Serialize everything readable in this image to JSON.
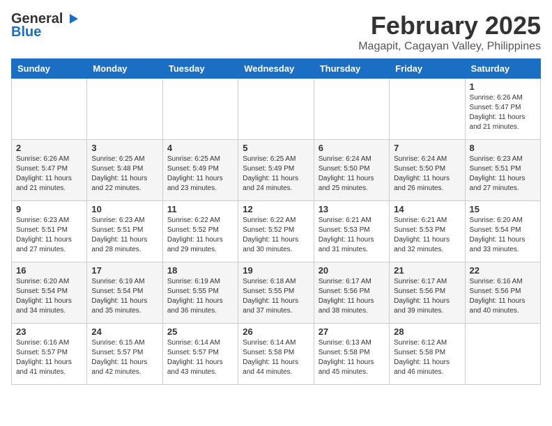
{
  "logo": {
    "general": "General",
    "blue": "Blue"
  },
  "title": "February 2025",
  "subtitle": "Magapit, Cagayan Valley, Philippines",
  "days_of_week": [
    "Sunday",
    "Monday",
    "Tuesday",
    "Wednesday",
    "Thursday",
    "Friday",
    "Saturday"
  ],
  "weeks": [
    [
      {
        "day": "",
        "info": ""
      },
      {
        "day": "",
        "info": ""
      },
      {
        "day": "",
        "info": ""
      },
      {
        "day": "",
        "info": ""
      },
      {
        "day": "",
        "info": ""
      },
      {
        "day": "",
        "info": ""
      },
      {
        "day": "1",
        "info": "Sunrise: 6:26 AM\nSunset: 5:47 PM\nDaylight: 11 hours\nand 21 minutes."
      }
    ],
    [
      {
        "day": "2",
        "info": "Sunrise: 6:26 AM\nSunset: 5:47 PM\nDaylight: 11 hours\nand 21 minutes."
      },
      {
        "day": "3",
        "info": "Sunrise: 6:25 AM\nSunset: 5:48 PM\nDaylight: 11 hours\nand 22 minutes."
      },
      {
        "day": "4",
        "info": "Sunrise: 6:25 AM\nSunset: 5:49 PM\nDaylight: 11 hours\nand 23 minutes."
      },
      {
        "day": "5",
        "info": "Sunrise: 6:25 AM\nSunset: 5:49 PM\nDaylight: 11 hours\nand 24 minutes."
      },
      {
        "day": "6",
        "info": "Sunrise: 6:24 AM\nSunset: 5:50 PM\nDaylight: 11 hours\nand 25 minutes."
      },
      {
        "day": "7",
        "info": "Sunrise: 6:24 AM\nSunset: 5:50 PM\nDaylight: 11 hours\nand 26 minutes."
      },
      {
        "day": "8",
        "info": "Sunrise: 6:23 AM\nSunset: 5:51 PM\nDaylight: 11 hours\nand 27 minutes."
      }
    ],
    [
      {
        "day": "9",
        "info": "Sunrise: 6:23 AM\nSunset: 5:51 PM\nDaylight: 11 hours\nand 27 minutes."
      },
      {
        "day": "10",
        "info": "Sunrise: 6:23 AM\nSunset: 5:51 PM\nDaylight: 11 hours\nand 28 minutes."
      },
      {
        "day": "11",
        "info": "Sunrise: 6:22 AM\nSunset: 5:52 PM\nDaylight: 11 hours\nand 29 minutes."
      },
      {
        "day": "12",
        "info": "Sunrise: 6:22 AM\nSunset: 5:52 PM\nDaylight: 11 hours\nand 30 minutes."
      },
      {
        "day": "13",
        "info": "Sunrise: 6:21 AM\nSunset: 5:53 PM\nDaylight: 11 hours\nand 31 minutes."
      },
      {
        "day": "14",
        "info": "Sunrise: 6:21 AM\nSunset: 5:53 PM\nDaylight: 11 hours\nand 32 minutes."
      },
      {
        "day": "15",
        "info": "Sunrise: 6:20 AM\nSunset: 5:54 PM\nDaylight: 11 hours\nand 33 minutes."
      }
    ],
    [
      {
        "day": "16",
        "info": "Sunrise: 6:20 AM\nSunset: 5:54 PM\nDaylight: 11 hours\nand 34 minutes."
      },
      {
        "day": "17",
        "info": "Sunrise: 6:19 AM\nSunset: 5:54 PM\nDaylight: 11 hours\nand 35 minutes."
      },
      {
        "day": "18",
        "info": "Sunrise: 6:19 AM\nSunset: 5:55 PM\nDaylight: 11 hours\nand 36 minutes."
      },
      {
        "day": "19",
        "info": "Sunrise: 6:18 AM\nSunset: 5:55 PM\nDaylight: 11 hours\nand 37 minutes."
      },
      {
        "day": "20",
        "info": "Sunrise: 6:17 AM\nSunset: 5:56 PM\nDaylight: 11 hours\nand 38 minutes."
      },
      {
        "day": "21",
        "info": "Sunrise: 6:17 AM\nSunset: 5:56 PM\nDaylight: 11 hours\nand 39 minutes."
      },
      {
        "day": "22",
        "info": "Sunrise: 6:16 AM\nSunset: 5:56 PM\nDaylight: 11 hours\nand 40 minutes."
      }
    ],
    [
      {
        "day": "23",
        "info": "Sunrise: 6:16 AM\nSunset: 5:57 PM\nDaylight: 11 hours\nand 41 minutes."
      },
      {
        "day": "24",
        "info": "Sunrise: 6:15 AM\nSunset: 5:57 PM\nDaylight: 11 hours\nand 42 minutes."
      },
      {
        "day": "25",
        "info": "Sunrise: 6:14 AM\nSunset: 5:57 PM\nDaylight: 11 hours\nand 43 minutes."
      },
      {
        "day": "26",
        "info": "Sunrise: 6:14 AM\nSunset: 5:58 PM\nDaylight: 11 hours\nand 44 minutes."
      },
      {
        "day": "27",
        "info": "Sunrise: 6:13 AM\nSunset: 5:58 PM\nDaylight: 11 hours\nand 45 minutes."
      },
      {
        "day": "28",
        "info": "Sunrise: 6:12 AM\nSunset: 5:58 PM\nDaylight: 11 hours\nand 46 minutes."
      },
      {
        "day": "",
        "info": ""
      }
    ]
  ]
}
